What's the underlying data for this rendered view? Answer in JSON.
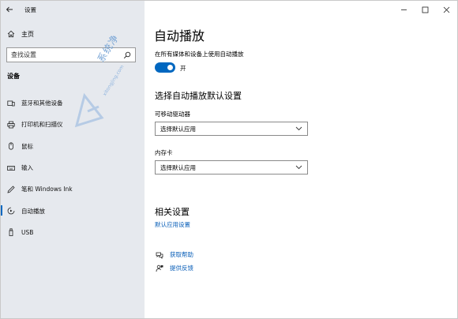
{
  "window": {
    "title": "设置"
  },
  "sidebar": {
    "home_label": "主页",
    "search": {
      "placeholder": "查找设置"
    },
    "section_title": "设备",
    "items": [
      {
        "label": "蓝牙和其他设备",
        "icon": "bluetooth-devices-icon"
      },
      {
        "label": "打印机和扫描仪",
        "icon": "printer-icon"
      },
      {
        "label": "鼠标",
        "icon": "mouse-icon"
      },
      {
        "label": "输入",
        "icon": "keyboard-icon"
      },
      {
        "label": "笔和 Windows Ink",
        "icon": "pen-icon"
      },
      {
        "label": "自动播放",
        "icon": "autoplay-icon",
        "active": true
      },
      {
        "label": "USB",
        "icon": "usb-icon"
      }
    ]
  },
  "watermark": {
    "text": "系统净",
    "url": "xitongjing.com"
  },
  "main": {
    "title": "自动播放",
    "toggle": {
      "description": "在所有媒体和设备上使用自动播放",
      "state_label": "开",
      "on": true
    },
    "defaults_heading": "选择自动播放默认设置",
    "removable_drive": {
      "label": "可移动驱动器",
      "value": "选择默认应用"
    },
    "memory_card": {
      "label": "内存卡",
      "value": "选择默认应用"
    },
    "related_heading": "相关设置",
    "related_link": "默认应用设置",
    "help_link": "获取帮助",
    "feedback_link": "提供反馈"
  },
  "colors": {
    "accent": "#0067c0",
    "sidebar_bg": "#e6e9ee",
    "link": "#0a5fb8"
  }
}
